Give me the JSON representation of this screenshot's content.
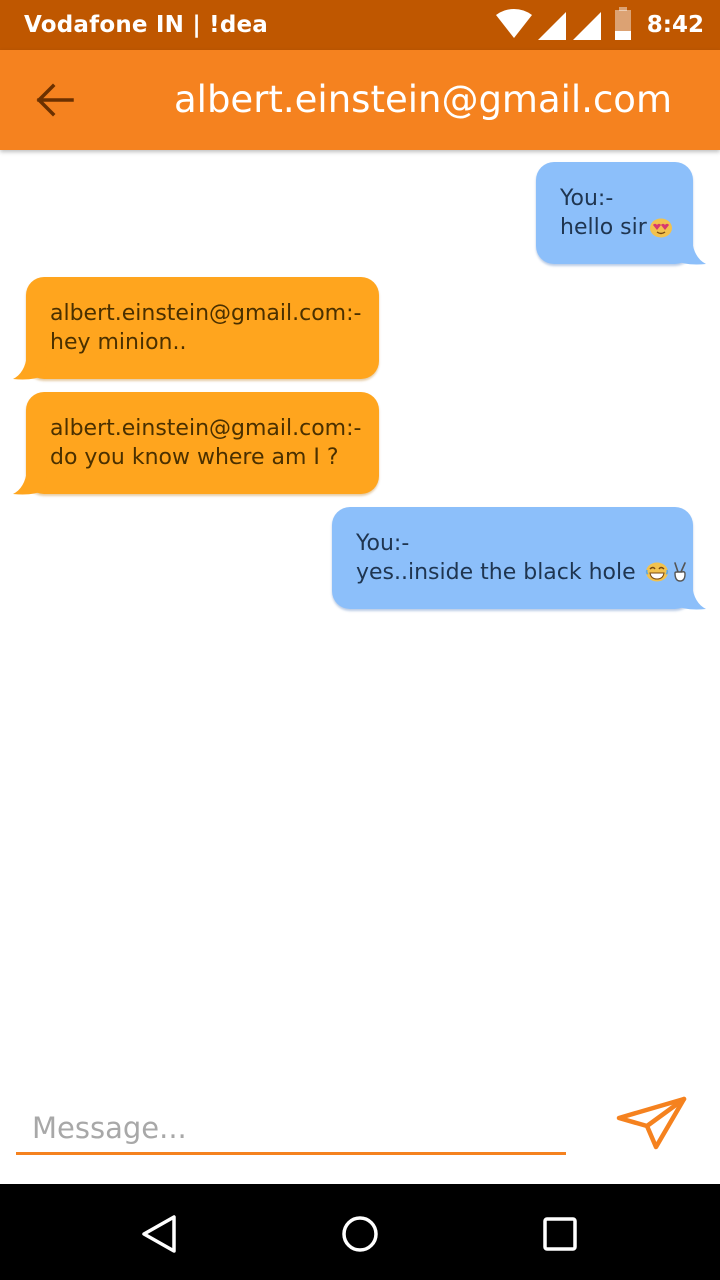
{
  "status_bar": {
    "carrier": "Vodafone IN | !dea",
    "time": "8:42"
  },
  "app_bar": {
    "title": "albert.einstein@gmail.com"
  },
  "messages": [
    {
      "type": "sent",
      "sender": "You:-",
      "text": "hello sir",
      "emoji": "heart-eyes-emoji"
    },
    {
      "type": "received",
      "sender": "albert.einstein@gmail.com:-",
      "text": "hey minion.."
    },
    {
      "type": "received",
      "sender": "albert.einstein@gmail.com:-",
      "text": "do you know where am I ?"
    },
    {
      "type": "sent",
      "sender": "You:-",
      "text": "yes..inside the black hole",
      "emoji": "laughing-emoji, victory-hand-emoji"
    }
  ],
  "composer": {
    "placeholder": "Message...",
    "value": ""
  },
  "colors": {
    "status_bar": "#BF5700",
    "app_bar": "#F5821F",
    "received_bubble": "#FFA51E",
    "sent_bubble": "#8CBFFA",
    "accent": "#F5821F"
  }
}
